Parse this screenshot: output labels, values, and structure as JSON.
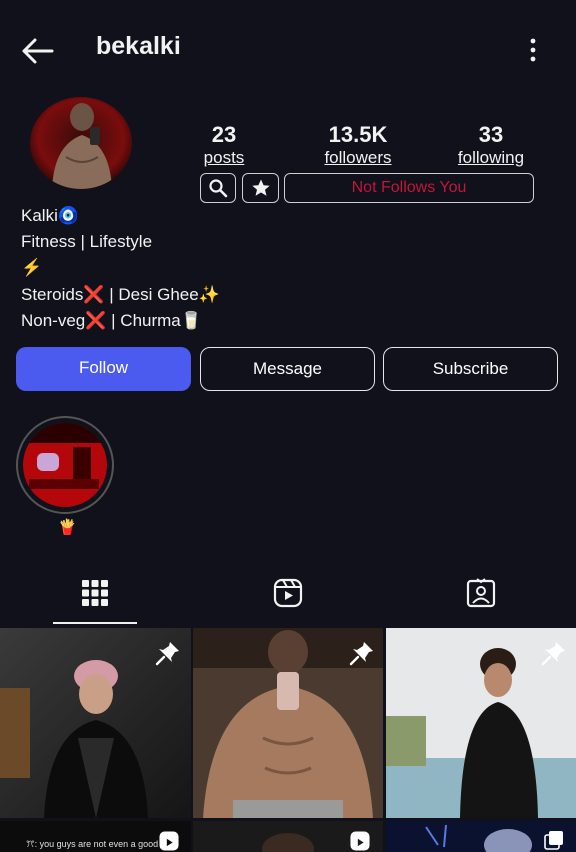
{
  "topbar": {
    "username": "bekalki"
  },
  "stats": {
    "posts_value": "23",
    "posts_label": "posts",
    "followers_value": "13.5K",
    "followers_label": "followers",
    "following_value": "33",
    "following_label": "following"
  },
  "relationship": {
    "status": "Not Follows You"
  },
  "bio": {
    "name": "Kalki🧿",
    "line1": "Fitness | Lifestyle",
    "line2": "⚡",
    "line3": "Steroids❌ | Desi Ghee✨",
    "line4": "Non-veg❌ | Churma🥛"
  },
  "actions": {
    "follow": "Follow",
    "message": "Message",
    "subscribe": "Subscribe"
  },
  "highlight": {
    "label": "🍟"
  },
  "bottom_row": {
    "caption": "ꔫ: you guys are not even a good du"
  },
  "colors": {
    "accent": "#4b5bf0",
    "status_red": "#c0173a",
    "background": "#10111a"
  },
  "icons": [
    "back-arrow-icon",
    "more-vert-icon",
    "search-icon",
    "star-icon",
    "grid-icon",
    "reels-icon",
    "tagged-icon",
    "pin-icon"
  ]
}
